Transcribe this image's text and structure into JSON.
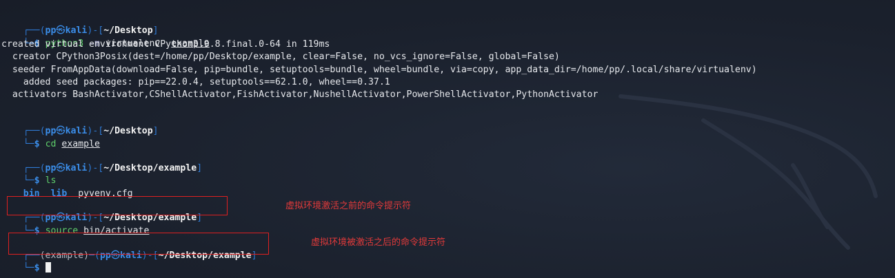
{
  "prompt": {
    "user": "pp",
    "skull": "㉿",
    "host": "kali",
    "dollar": "$"
  },
  "blocks": [
    {
      "path": "~/Desktop",
      "command": "python3",
      "option": "-m",
      "arg1": "virtualenv",
      "arg2": "example",
      "output": [
        "created virtual environment CPython3.9.8.final.0-64 in 119ms",
        "  creator CPython3Posix(dest=/home/pp/Desktop/example, clear=False, no_vcs_ignore=False, global=False)",
        "  seeder FromAppData(download=False, pip=bundle, setuptools=bundle, wheel=bundle, via=copy, app_data_dir=/home/pp/.local/share/virtualenv)",
        "    added seed packages: pip==22.0.4, setuptools==62.1.0, wheel==0.37.1",
        "  activators BashActivator,CShellActivator,FishActivator,NushellActivator,PowerShellActivator,PythonActivator"
      ]
    },
    {
      "path": "~/Desktop",
      "command": "cd",
      "arg": "example"
    },
    {
      "path": "~/Desktop/example",
      "command": "ls",
      "ls_output": [
        "bin",
        "lib",
        "pyvenv.cfg"
      ]
    },
    {
      "path": "~/Desktop/example",
      "command": "source",
      "arg": "bin/activate"
    },
    {
      "venv": "(example)",
      "path": "~/Desktop/example"
    }
  ],
  "annotations": {
    "before": "虚拟环境激活之前的命令提示符",
    "after": "虚拟环境被激活之后的命令提示符"
  },
  "colors": {
    "background": "#1c2230",
    "prompt_blue": "#3b8eea",
    "command_green": "#5fcf6b",
    "annotation_red": "#e02020"
  }
}
